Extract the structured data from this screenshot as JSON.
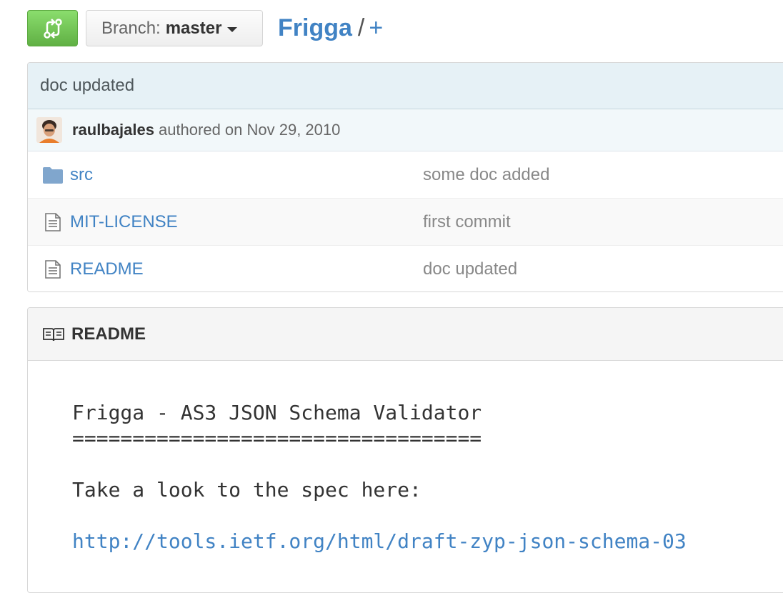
{
  "branch": {
    "label": "Branch:",
    "value": "master"
  },
  "breadcrumb": {
    "repo": "Frigga",
    "separator": "/",
    "add": "+"
  },
  "commit": {
    "message": "doc updated",
    "author": "raulbajales",
    "action": "authored on Nov 29, 2010"
  },
  "files": [
    {
      "type": "folder",
      "icon": "folder-icon",
      "name": "src",
      "message": "some doc added"
    },
    {
      "type": "file",
      "icon": "file-icon",
      "name": "MIT-LICENSE",
      "message": "first commit"
    },
    {
      "type": "file",
      "icon": "file-icon",
      "name": "README",
      "message": "doc updated"
    }
  ],
  "readme": {
    "heading": "README",
    "title": "Frigga - AS3 JSON Schema Validator",
    "underline": "==================================",
    "spec_text": "Take a look to the spec here:",
    "spec_link": "http://tools.ietf.org/html/draft-zyp-json-schema-03"
  },
  "colors": {
    "link": "#4183c4",
    "compare_button": "#6cc644",
    "commit_bar": "#e6f1f6"
  }
}
